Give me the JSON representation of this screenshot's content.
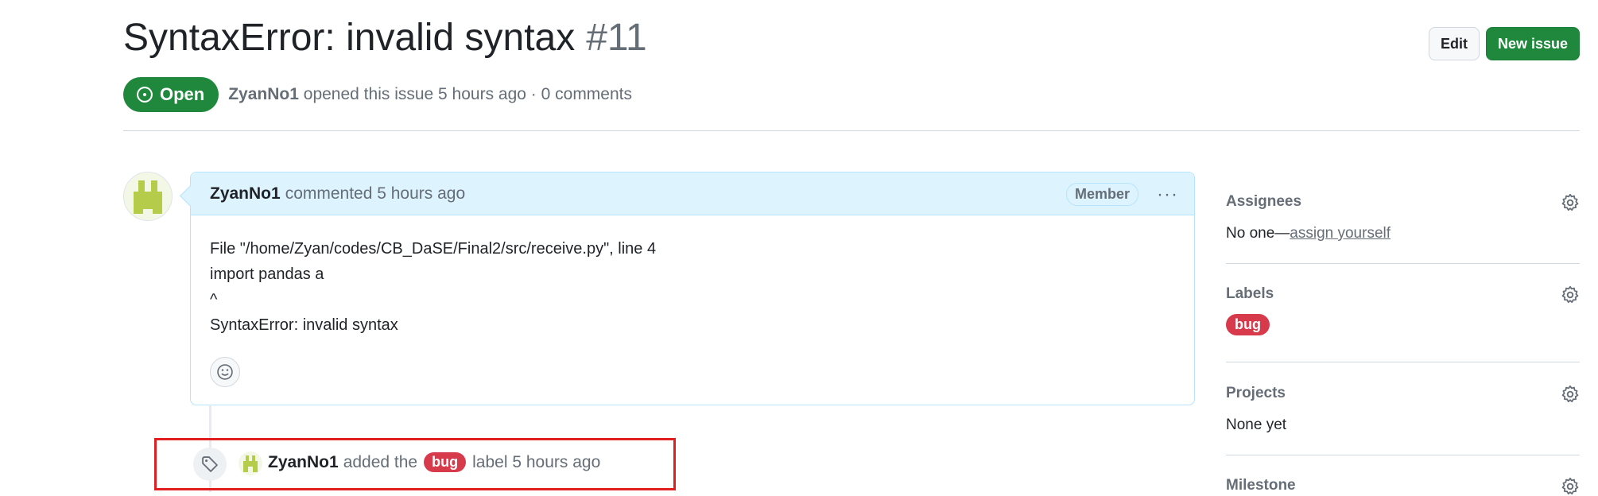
{
  "issue": {
    "title": "SyntaxError: invalid syntax",
    "number": "#11",
    "state": "Open",
    "author": "ZyanNo1",
    "meta": "opened this issue 5 hours ago · 0 comments"
  },
  "header_buttons": {
    "edit": "Edit",
    "new_issue": "New issue"
  },
  "comment": {
    "author": "ZyanNo1",
    "action": "commented 5 hours ago",
    "badge": "Member",
    "more": "···",
    "body_lines": [
      "File \"/home/Zyan/codes/CB_DaSE/Final2/src/receive.py\", line 4",
      "import pandas a",
      "^",
      "SyntaxError: invalid syntax"
    ]
  },
  "event": {
    "author": "ZyanNo1",
    "pre": "added the",
    "label": "bug",
    "post": "label 5 hours ago"
  },
  "sidebar": {
    "assignees": {
      "heading": "Assignees",
      "value_prefix": "No one—",
      "value_link": "assign yourself"
    },
    "labels": {
      "heading": "Labels",
      "label": "bug"
    },
    "projects": {
      "heading": "Projects",
      "value": "None yet"
    },
    "milestone": {
      "heading": "Milestone"
    }
  },
  "colors": {
    "open_green": "#1f883d",
    "bug_red": "#d73a4a",
    "highlight": "#e02020"
  }
}
